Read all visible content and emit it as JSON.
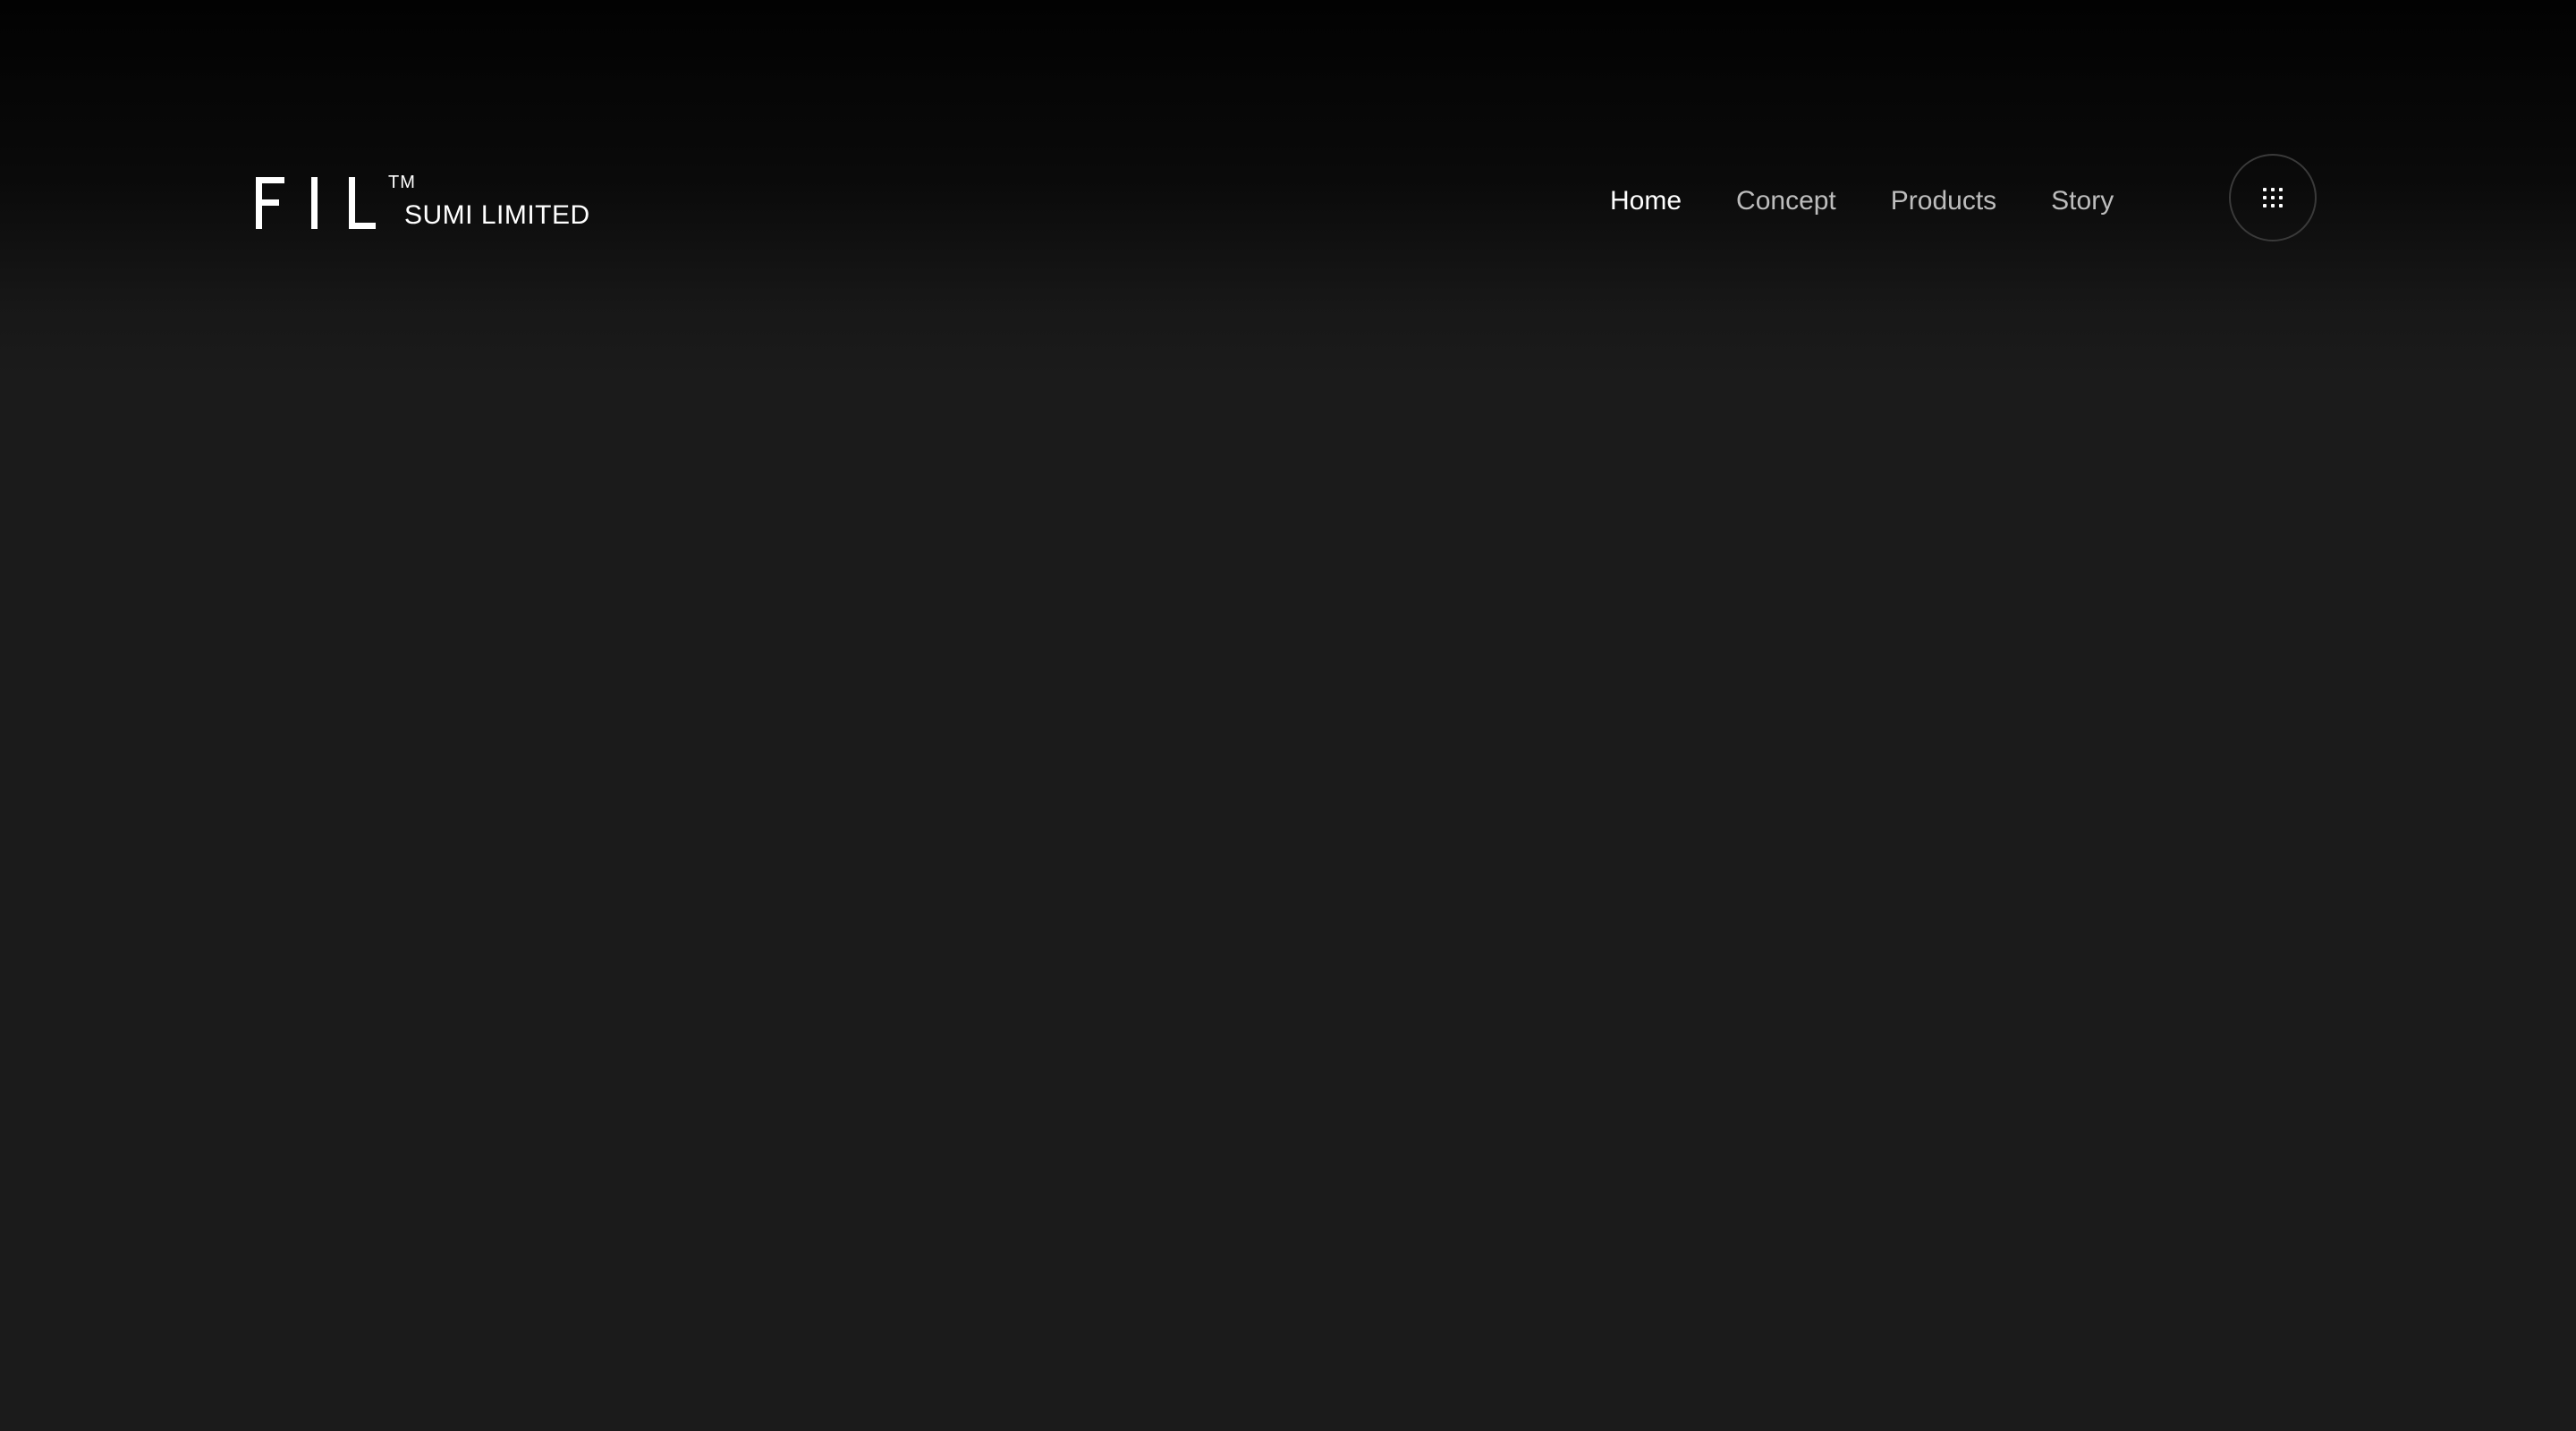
{
  "header": {
    "logo": {
      "mark": "FIL",
      "trademark": "TM",
      "subtitle": "SUMI LIMITED"
    },
    "nav": {
      "items": [
        {
          "label": "Home",
          "active": true
        },
        {
          "label": "Concept",
          "active": false
        },
        {
          "label": "Products",
          "active": false
        },
        {
          "label": "Story",
          "active": false
        }
      ]
    },
    "menu_button": {
      "icon": "grid-dots-icon"
    }
  },
  "colors": {
    "background": "#1b1b1b",
    "header_top": "#020202",
    "nav_active": "#ffffff",
    "nav_inactive": "#bdbdbd",
    "menu_border": "#3a3a3a"
  }
}
